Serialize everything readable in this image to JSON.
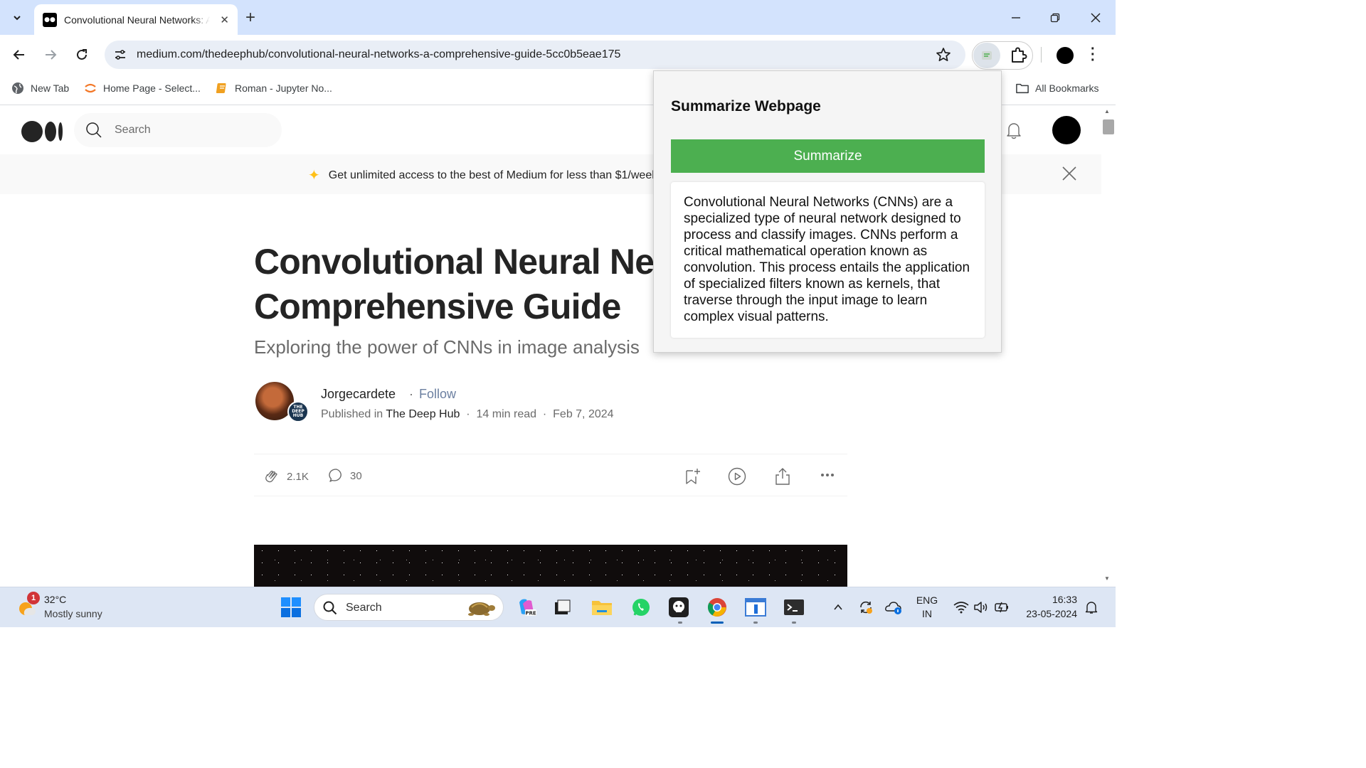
{
  "browser": {
    "tab": {
      "title": "Convolutional Neural Networks: A Comprehensive Guide",
      "favicon": "medium-icon"
    },
    "url": "medium.com/thedeephub/convolutional-neural-networks-a-comprehensive-guide-5cc0b5eae175",
    "bookmarks": [
      {
        "label": "New Tab",
        "icon": "globe-icon"
      },
      {
        "label": "Home Page - Select...",
        "icon": "jupyter-icon"
      },
      {
        "label": "Roman - Jupyter No...",
        "icon": "notebook-icon"
      }
    ],
    "all_bookmarks_label": "All Bookmarks"
  },
  "medium": {
    "search_placeholder": "Search",
    "banner_text": "Get unlimited access to the best of Medium for less than $1/week.",
    "article": {
      "title": "Convolutional Neural Networks: A Comprehensive Guide",
      "subtitle": "Exploring the power of CNNs in image analysis",
      "author": "Jorgecardete",
      "follow_label": "Follow",
      "published_in_label": "Published in",
      "publication": "The Deep Hub",
      "read_time": "14 min read",
      "date": "Feb 7, 2024",
      "publication_badge": "THE DEEP HUB",
      "claps": "2.1K",
      "comments": "30"
    }
  },
  "popup": {
    "title": "Summarize Webpage",
    "button_label": "Summarize",
    "summary": "Convolutional Neural Networks (CNNs) are a specialized type of neural network designed to process and classify images. CNNs perform a critical mathematical operation known as convolution. This process entails the application of specialized filters known as kernels, that traverse through the input image to learn complex visual patterns."
  },
  "taskbar": {
    "weather_temp": "32°C",
    "weather_desc": "Mostly sunny",
    "weather_badge": "1",
    "search_placeholder": "Search",
    "language": "ENG",
    "region": "IN",
    "time": "16:33",
    "date": "23-05-2024"
  },
  "colors": {
    "tabstrip": "#d3e3fd",
    "summarize_button": "#4caf50",
    "banner_star": "#ffc017"
  }
}
